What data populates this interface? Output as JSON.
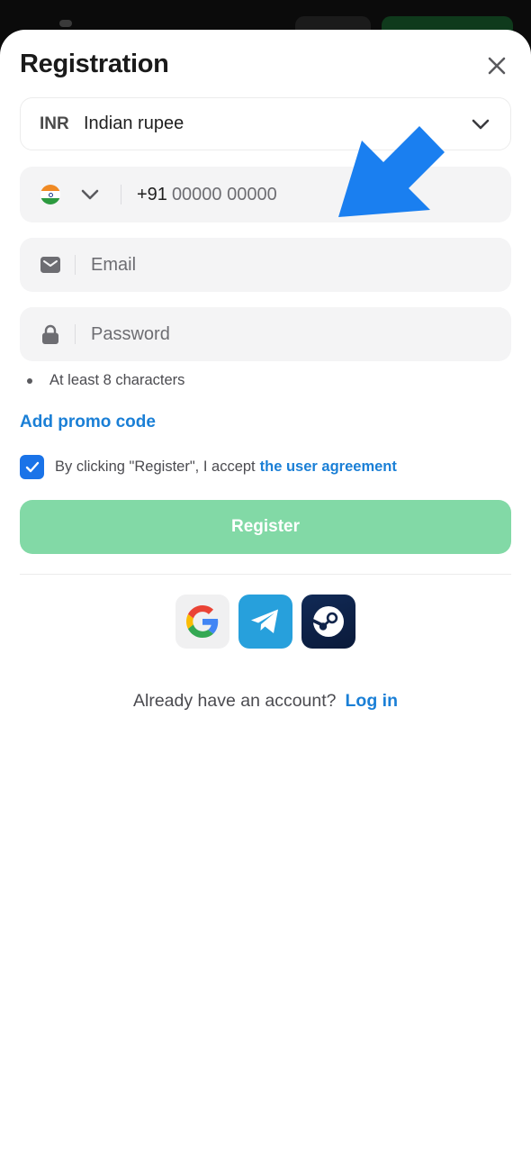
{
  "title": "Registration",
  "currency": {
    "code": "INR",
    "name": "Indian rupee"
  },
  "phone": {
    "dial_code": "+91",
    "placeholder": "00000 00000",
    "flag": "india-flag-icon"
  },
  "email": {
    "placeholder": "Email"
  },
  "password": {
    "placeholder": "Password",
    "hint": "At least 8 characters"
  },
  "promo": {
    "label": "Add promo code"
  },
  "agreement": {
    "text": "By clicking \"Register\", I accept",
    "link": "the user agreement",
    "checked": true
  },
  "register": {
    "label": "Register"
  },
  "socials": [
    {
      "name": "google",
      "icon": "google-icon"
    },
    {
      "name": "telegram",
      "icon": "telegram-icon"
    },
    {
      "name": "steam",
      "icon": "steam-icon"
    }
  ],
  "login": {
    "prompt": "Already have an account?",
    "link": "Log in"
  },
  "colors": {
    "accent": "#1a7fd6",
    "register_bg": "#82d9a6",
    "checkbox": "#1a73e8",
    "field_bg": "#f4f4f5",
    "arrow": "#1a7ff0"
  }
}
